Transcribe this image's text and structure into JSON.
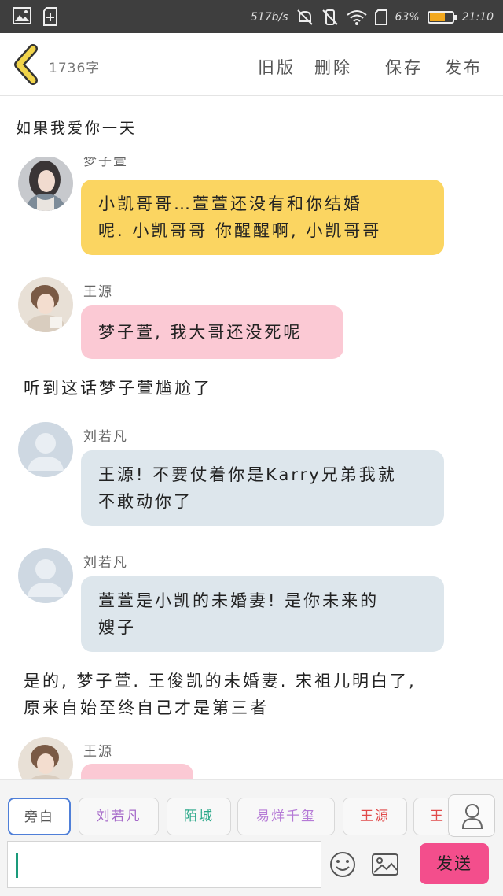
{
  "status_bar": {
    "speed": "517b/s",
    "battery_percent": "63%",
    "battery_level": 0.63,
    "time": "21:10",
    "icons": [
      "image-icon",
      "sim-add-icon",
      "mute-icon",
      "vibrate-off-icon",
      "wifi-icon",
      "sim-card-icon",
      "battery-icon"
    ]
  },
  "header": {
    "word_count": "1736字",
    "old_version": "旧版",
    "delete": "删除",
    "save": "保存",
    "publish": "发布"
  },
  "story": {
    "title": "如果我爱你一天"
  },
  "messages": [
    {
      "type": "dialog",
      "name": "梦子萱",
      "avatar": "photo-girl",
      "color": "yellow",
      "lines": [
        "小凯哥哥…萱萱还没有和你结婚",
        "呢. 小凯哥哥 你醒醒啊, 小凯哥哥"
      ]
    },
    {
      "type": "dialog",
      "name": "王源",
      "avatar": "photo-boy",
      "color": "pink",
      "lines": [
        "梦子萱, 我大哥还没死呢"
      ]
    },
    {
      "type": "narration",
      "lines": [
        "听到这话梦子萱尴尬了"
      ]
    },
    {
      "type": "dialog",
      "name": "刘若凡",
      "avatar": "default",
      "color": "gray",
      "lines": [
        "王源! 不要仗着你是Karry兄弟我就",
        "不敢动你了"
      ]
    },
    {
      "type": "dialog",
      "name": "刘若凡",
      "avatar": "default",
      "color": "gray",
      "lines": [
        "萱萱是小凯的未婚妻! 是你未来的",
        "嫂子"
      ]
    },
    {
      "type": "narration",
      "lines": [
        "是的, 梦子萱. 王俊凯的未婚妻. 宋祖儿明白了,",
        "原来自始至终自己才是第三者"
      ]
    },
    {
      "type": "dialog",
      "name": "王源",
      "avatar": "photo-boy",
      "color": "pink",
      "lines": [
        ""
      ]
    }
  ],
  "roles": [
    {
      "label": "旁白",
      "color": "#555555"
    },
    {
      "label": "刘若凡",
      "color": "#a66ac9"
    },
    {
      "label": "陌城",
      "color": "#2aa889"
    },
    {
      "label": "易烊千玺",
      "color": "#b57ad6"
    },
    {
      "label": "王源",
      "color": "#e04a4a"
    },
    {
      "label": "王",
      "color": "#e04a4a"
    }
  ],
  "input": {
    "placeholder": "",
    "send": "发送"
  },
  "colors": {
    "yellow": "#fbd561",
    "pink": "#fbc9d4",
    "gray": "#dde6ec",
    "send": "#f34e8c",
    "back_arrow": "#f1d44a"
  }
}
